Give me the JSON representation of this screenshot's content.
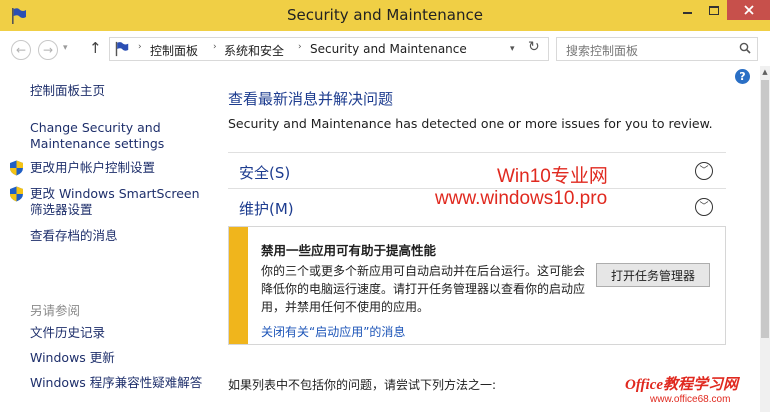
{
  "window": {
    "title": "Security and Maintenance"
  },
  "nav": {
    "back_glyph": "←",
    "forward_glyph": "→",
    "dropdown_glyph": "▾",
    "up_glyph": "↑",
    "breadcrumb": [
      "控制面板",
      "系统和安全",
      "Security and Maintenance"
    ],
    "crumb_sep": "›",
    "refresh_glyph": "↻",
    "search_placeholder": "搜索控制面板"
  },
  "help_glyph": "?",
  "sidebar": {
    "home": "控制面板主页",
    "change_settings": [
      "Change Security and",
      "Maintenance settings"
    ],
    "uac": "更改用户帐户控制设置",
    "smartscreen": [
      "更改 Windows SmartScreen",
      "筛选器设置"
    ],
    "archived": "查看存档的消息",
    "see_also": "另请参阅",
    "file_history": "文件历史记录",
    "windows_update": "Windows 更新",
    "compat": "Windows 程序兼容性疑难解答"
  },
  "main": {
    "heading": "查看最新消息并解决问题",
    "description": "Security and Maintenance has detected one or more issues for you to review.",
    "sections": {
      "security": {
        "label": "安全(S)",
        "chevron": "﹀"
      },
      "maintenance": {
        "label": "维护(M)",
        "chevron": "﹀"
      }
    },
    "alert": {
      "title": "禁用一些应用可有助于提高性能",
      "body": "你的三个或更多个新应用可自动启动并在后台运行。这可能会降低你的电脑运行速度。请打开任务管理器以查看你的启动应用，并禁用任何不使用的应用。",
      "link": "关闭有关“启动应用”的消息",
      "button": "打开任务管理器"
    },
    "footer": "如果列表中不包括你的问题，请尝试下列方法之一:"
  },
  "watermarks": {
    "site1": "Win10专业网",
    "site2": "www.windows10.pro",
    "site3": "Office教程学习网",
    "site4": "www.office68.com"
  },
  "colors": {
    "titlebar": "#f0cf45",
    "close_button": "#c7504b",
    "link_blue": "#1d3c8f",
    "alert_bar": "#f0b51c",
    "watermark_red": "#e0291f"
  },
  "icons": {
    "title": "control-panel-flag-icon",
    "address": "control-panel-flag-icon",
    "search": "search-icon",
    "uac": "uac-shield-icon",
    "smartscreen": "uac-shield-icon"
  }
}
